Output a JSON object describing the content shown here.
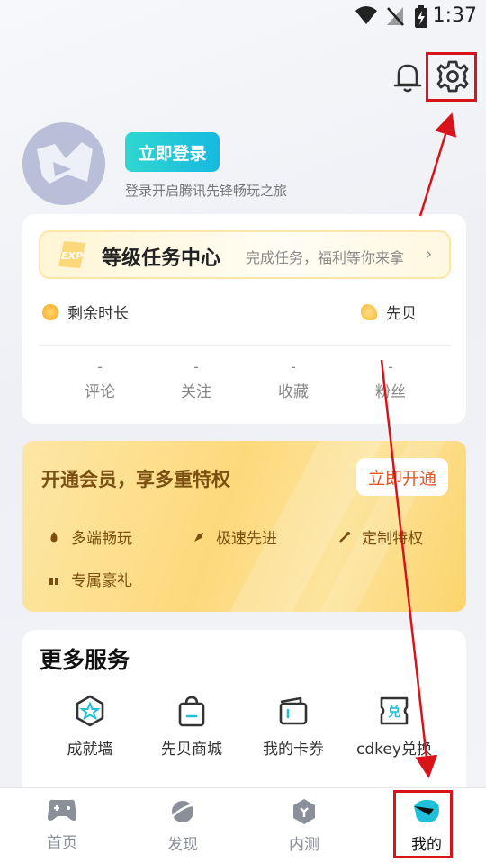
{
  "status_bar": {
    "time": "1:37"
  },
  "header": {
    "notification_icon": "bell-icon",
    "settings_icon": "gear-icon"
  },
  "profile": {
    "login_button": "立即登录",
    "login_subtitle": "登录开启腾讯先锋畅玩之旅"
  },
  "level_task": {
    "badge": "EXP",
    "title": "等级任务中心",
    "subtitle": "完成任务，福利等你来拿"
  },
  "stats": {
    "remaining_time_label": "剩余时长",
    "xianbei_label": "先贝",
    "counters": [
      {
        "value": "-",
        "label": "评论"
      },
      {
        "value": "-",
        "label": "关注"
      },
      {
        "value": "-",
        "label": "收藏"
      },
      {
        "value": "-",
        "label": "粉丝"
      }
    ]
  },
  "vip": {
    "title": "开通会员，享多重特权",
    "button": "立即开通",
    "perks": [
      "多端畅玩",
      "极速先进",
      "定制特权",
      "专属豪礼"
    ]
  },
  "services": {
    "title": "更多服务",
    "items": [
      {
        "label": "成就墙",
        "icon": "achievement-icon"
      },
      {
        "label": "先贝商城",
        "icon": "shop-bag-icon"
      },
      {
        "label": "我的卡券",
        "icon": "wallet-icon"
      },
      {
        "label": "cdkey兑换",
        "icon": "exchange-icon"
      }
    ]
  },
  "bottom_nav": {
    "items": [
      {
        "label": "首页",
        "icon": "gamepad-icon"
      },
      {
        "label": "发现",
        "icon": "planet-icon"
      },
      {
        "label": "内测",
        "icon": "hexagon-icon"
      },
      {
        "label": "我的",
        "icon": "profile-face-icon"
      }
    ],
    "active_index": 3
  },
  "annotation_color": "#d8141a"
}
